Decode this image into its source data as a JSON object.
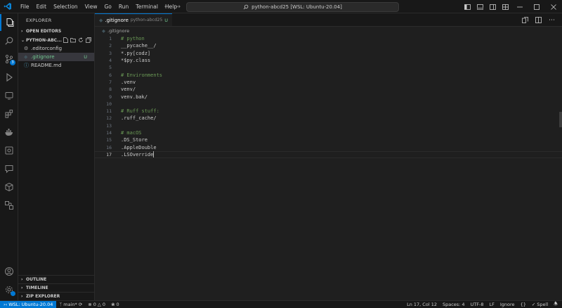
{
  "menu": [
    "File",
    "Edit",
    "Selection",
    "View",
    "Go",
    "Run",
    "Terminal",
    "Help"
  ],
  "command_center": "python-abcd25 [WSL: Ubuntu-20.04]",
  "activity": {
    "scm_badge": "3"
  },
  "explorer": {
    "title": "EXPLORER",
    "open_editors": "OPEN EDITORS",
    "folder": "PYTHON-ABC...",
    "files": [
      {
        "name": ".editorconfig",
        "icon": "⚙",
        "status": ""
      },
      {
        "name": ".gitignore",
        "icon": "◆",
        "status": "U"
      },
      {
        "name": "README.md",
        "icon": "ⓘ",
        "status": ""
      }
    ],
    "outline": "OUTLINE",
    "timeline": "TIMELINE",
    "zip": "ZIP EXPLORER"
  },
  "tab": {
    "name": ".gitignore",
    "desc": "python-abcd25",
    "mod": "U"
  },
  "breadcrumb": ".gitignore",
  "code": [
    {
      "n": "1",
      "t": "# python",
      "c": true
    },
    {
      "n": "2",
      "t": "__pycache__/",
      "c": false
    },
    {
      "n": "3",
      "t": "*.py[codz]",
      "c": false
    },
    {
      "n": "4",
      "t": "*$py.class",
      "c": false
    },
    {
      "n": "5",
      "t": "",
      "c": false
    },
    {
      "n": "6",
      "t": "# Environments",
      "c": true
    },
    {
      "n": "7",
      "t": ".venv",
      "c": false
    },
    {
      "n": "8",
      "t": "venv/",
      "c": false
    },
    {
      "n": "9",
      "t": "venv.bak/",
      "c": false
    },
    {
      "n": "10",
      "t": "",
      "c": false
    },
    {
      "n": "11",
      "t": "# Ruff stuff:",
      "c": true
    },
    {
      "n": "12",
      "t": ".ruff_cache/",
      "c": false
    },
    {
      "n": "13",
      "t": "",
      "c": false
    },
    {
      "n": "14",
      "t": "# macOS",
      "c": true
    },
    {
      "n": "15",
      "t": ".DS_Store",
      "c": false
    },
    {
      "n": "16",
      "t": ".AppleDouble",
      "c": false
    },
    {
      "n": "17",
      "t": ".LSOverride",
      "c": false
    }
  ],
  "status": {
    "remote": "WSL: Ubuntu-20.04",
    "branch": "main*",
    "errors": "0",
    "warnings": "0",
    "ports": "0",
    "position": "Ln 17, Col 12",
    "spaces": "Spaces: 4",
    "encoding": "UTF-8",
    "eol": "LF",
    "language": "Ignore",
    "spell": "Spell"
  },
  "colors": {
    "accent": "#0078d4",
    "untracked": "#73c991",
    "comment": "#6a9955"
  }
}
